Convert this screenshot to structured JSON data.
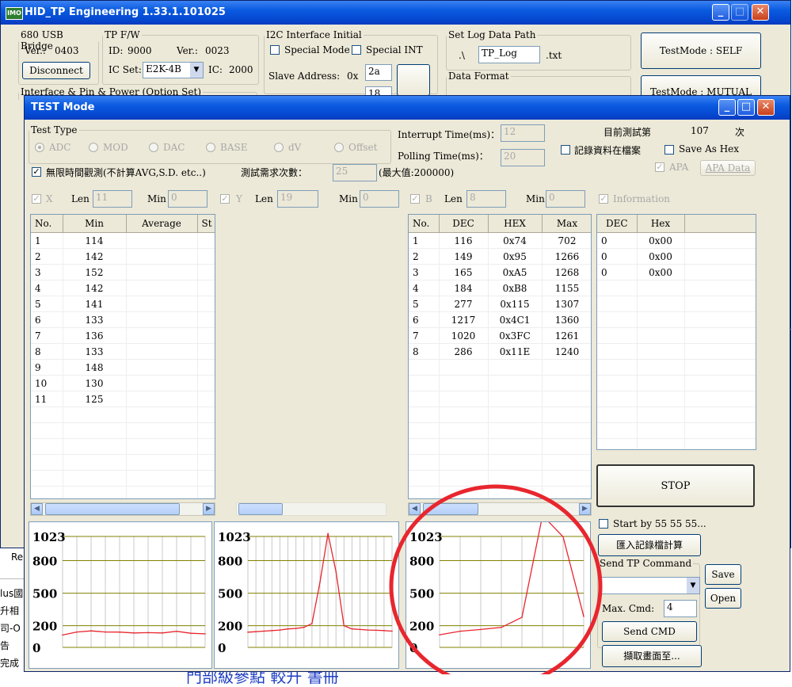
{
  "main_window": {
    "title": "HID_TP Engineering 1.33.1.101025",
    "app_icon_text": "IMO",
    "usb_bridge": {
      "legend": "680 USB Bridge",
      "ver_label": "Ver.:",
      "ver_value": "0403",
      "disconnect_label": "Disconnect"
    },
    "tp_fw": {
      "legend": "TP F/W",
      "id_label": "ID:",
      "id_value": "9000",
      "ver_label": "Ver.:",
      "ver_value": "0023",
      "ic_set_label": "IC Set:",
      "ic_set_value": "E2K-4B",
      "ic_label": "IC:",
      "ic_value": "2000"
    },
    "i2c": {
      "legend": "I2C Interface Initial",
      "special_mode_label": "Special Mode",
      "special_int_label": "Special INT",
      "slave_address_label": "Slave Address:",
      "slave_prefix": "0x",
      "slave_value": "2a",
      "partial_value": "18"
    },
    "log_path": {
      "legend": "Set Log Data Path",
      "dir_value": ".\\",
      "file_value": "TP_Log",
      "ext_label": ".txt"
    },
    "data_format_legend": "Data Format",
    "interface_legend_partial": "Interface & Pin & Power (Option Set)",
    "testmode_self_label": "TestMode : SELF",
    "testmode_mutual_label": "TestMode : MUTUAL",
    "left_partial_texts": [
      "Re",
      "lus國",
      "升相",
      "司-O",
      "告",
      "完成"
    ],
    "right_partial_text": "e",
    "bottom_partial_text": "門部級參點 較升 書冊"
  },
  "test_window": {
    "title": "TEST Mode",
    "test_type": {
      "legend": "Test Type",
      "options": [
        "ADC",
        "MOD",
        "DAC",
        "BASE",
        "dV",
        "Offset"
      ],
      "selected": "ADC"
    },
    "interrupt_time_label": "Interrupt Time(ms)：",
    "interrupt_time_value": "12",
    "polling_time_label": "Polling Time(ms)：",
    "polling_time_value": "20",
    "current_test_label": "目前測試第",
    "current_test_count": "107",
    "current_test_suffix": "次",
    "record_to_file_label": "記錄資料在檔案",
    "save_as_hex_label": "Save As Hex",
    "apa_label": "APA",
    "apa_data_label": "APA Data",
    "unlimited_label": "無限時間觀測(不計算AVG,S.D. etc..)",
    "test_count_label": "測試需求次數：",
    "test_count_value": "25",
    "max_value_label": "(最大值:200000)",
    "x_filter": {
      "label": "X",
      "len_label": "Len",
      "len_value": "11",
      "min_label": "Min",
      "min_value": "0"
    },
    "y_filter": {
      "label": "Y",
      "len_label": "Len",
      "len_value": "19",
      "min_label": "Min",
      "min_value": "0"
    },
    "b_filter": {
      "label": "B",
      "len_label": "Len",
      "len_value": "8",
      "min_label": "Min",
      "min_value": "0"
    },
    "information_label": "Information",
    "x_table": {
      "headers": [
        "No.",
        "Min",
        "Average",
        "St"
      ],
      "rows": [
        [
          "1",
          "114"
        ],
        [
          "2",
          "142"
        ],
        [
          "3",
          "152"
        ],
        [
          "4",
          "142"
        ],
        [
          "5",
          "141"
        ],
        [
          "6",
          "133"
        ],
        [
          "7",
          "136"
        ],
        [
          "8",
          "133"
        ],
        [
          "9",
          "148"
        ],
        [
          "10",
          "130"
        ],
        [
          "11",
          "125"
        ]
      ]
    },
    "b_table": {
      "headers": [
        "No.",
        "DEC",
        "HEX",
        "Max"
      ],
      "rows": [
        [
          "1",
          "116",
          "0x74",
          "702"
        ],
        [
          "2",
          "149",
          "0x95",
          "1266"
        ],
        [
          "3",
          "165",
          "0xA5",
          "1268"
        ],
        [
          "4",
          "184",
          "0xB8",
          "1155"
        ],
        [
          "5",
          "277",
          "0x115",
          "1307"
        ],
        [
          "6",
          "1217",
          "0x4C1",
          "1360"
        ],
        [
          "7",
          "1020",
          "0x3FC",
          "1261"
        ],
        [
          "8",
          "286",
          "0x11E",
          "1240"
        ]
      ]
    },
    "info_table": {
      "headers": [
        "DEC",
        "Hex"
      ],
      "rows": [
        [
          "0",
          "0x00"
        ],
        [
          "0",
          "0x00"
        ],
        [
          "0",
          "0x00"
        ]
      ]
    },
    "stop_label": "STOP",
    "start_by_label": "Start by 55 55 55...",
    "import_record_label": "匯入記錄檔計算",
    "send_tp_command_legend": "Send TP Command",
    "save_label": "Save",
    "open_label": "Open",
    "max_cmd_label": "Max. Cmd:",
    "max_cmd_value": "4",
    "send_cmd_label": "Send CMD",
    "capture_label": "擷取畫面至...",
    "charts_y_ticks": [
      "1023",
      "800",
      "500",
      "200",
      "0"
    ]
  },
  "colors": {
    "line": "#e8262e",
    "annotation_circle": "#e8262e",
    "gridline": "#808000",
    "xp_blue": "#0a5ae0"
  },
  "chart_data": [
    {
      "type": "line",
      "title": "",
      "ylim": [
        0,
        1023
      ],
      "yticks": [
        1023,
        800,
        500,
        200,
        0
      ],
      "grid": true,
      "series": [
        {
          "values": [
            114,
            142,
            152,
            142,
            141,
            133,
            136,
            133,
            148,
            130,
            125
          ]
        }
      ]
    },
    {
      "type": "line",
      "title": "",
      "ylim": [
        0,
        1023
      ],
      "yticks": [
        1023,
        800,
        500,
        200,
        0
      ],
      "grid": true,
      "series": [
        {
          "values": [
            140,
            145,
            150,
            155,
            160,
            170,
            175,
            185,
            220,
            600,
            1050,
            700,
            200,
            170,
            165,
            160,
            158,
            155,
            150
          ]
        }
      ]
    },
    {
      "type": "line",
      "title": "",
      "ylim": [
        0,
        1023
      ],
      "yticks": [
        1023,
        800,
        500,
        200,
        0
      ],
      "grid": true,
      "series": [
        {
          "values": [
            116,
            149,
            165,
            184,
            277,
            1217,
            1020,
            286
          ]
        }
      ]
    }
  ]
}
